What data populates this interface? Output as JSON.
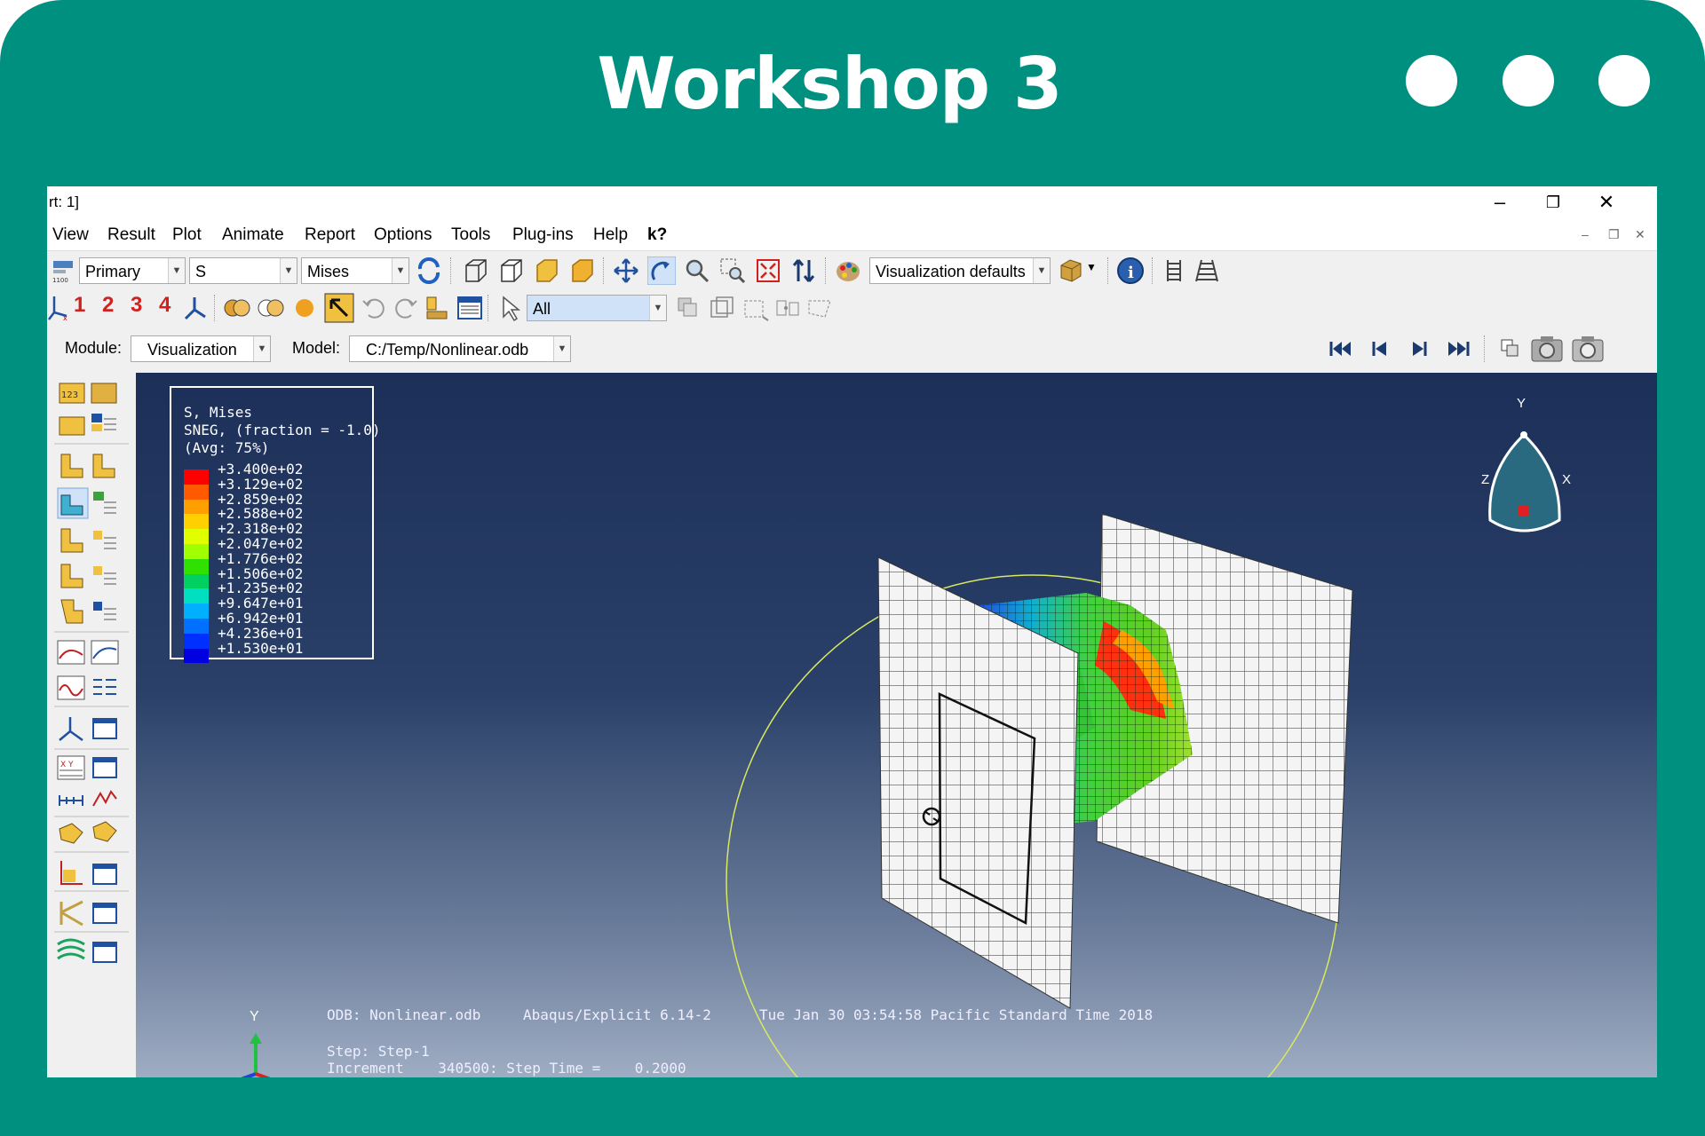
{
  "header": {
    "title": "Workshop 3"
  },
  "window": {
    "title_fragment": "rt: 1]",
    "controls": [
      "–",
      "❐",
      "✕"
    ]
  },
  "menubar": {
    "items": [
      {
        "label": "View"
      },
      {
        "label": "Result"
      },
      {
        "label": "Plot"
      },
      {
        "label": "Animate"
      },
      {
        "label": "Report"
      },
      {
        "label": "Options"
      },
      {
        "label": "Tools"
      },
      {
        "label": "Plug-ins"
      },
      {
        "label": "Help"
      },
      {
        "label": "k?"
      }
    ]
  },
  "toolbar1": {
    "field_output_step": "Primary",
    "field_variable": "S",
    "invariant": "Mises",
    "render_style": "Visualization defaults"
  },
  "toolbar2": {
    "view_numbers": [
      "1",
      "2",
      "3",
      "4"
    ],
    "selection_filter": "All"
  },
  "context_bar": {
    "module_label": "Module:",
    "module_value": "Visualization",
    "model_label": "Model:",
    "model_value": "C:/Temp/Nonlinear.odb"
  },
  "legend": {
    "line1": "S, Mises",
    "line2": "SNEG, (fraction = -1.0)",
    "line3": "(Avg: 75%)",
    "values": [
      "+3.400e+02",
      "+3.129e+02",
      "+2.859e+02",
      "+2.588e+02",
      "+2.318e+02",
      "+2.047e+02",
      "+1.776e+02",
      "+1.506e+02",
      "+1.235e+02",
      "+9.647e+01",
      "+6.942e+01",
      "+4.236e+01",
      "+1.530e+01"
    ],
    "colors": [
      "#ff0000",
      "#ff5a00",
      "#ffa000",
      "#ffd000",
      "#e0ff00",
      "#a0ff00",
      "#30e000",
      "#00d060",
      "#00e0c0",
      "#00b0ff",
      "#0070ff",
      "#0030ff",
      "#0000e0"
    ]
  },
  "triad": {
    "y": "Y",
    "z": "Z",
    "x": "X"
  },
  "viewport_info": {
    "odb": "ODB: Nonlinear.odb",
    "solver": "Abaqus/Explicit 6.14-2",
    "date": "Tue Jan 30 03:54:58 Pacific Standard Time 2018",
    "step": "Step: Step-1",
    "increment": "Increment    340500: Step Time =    0.2000"
  },
  "small_triad": {
    "y": "Y"
  }
}
